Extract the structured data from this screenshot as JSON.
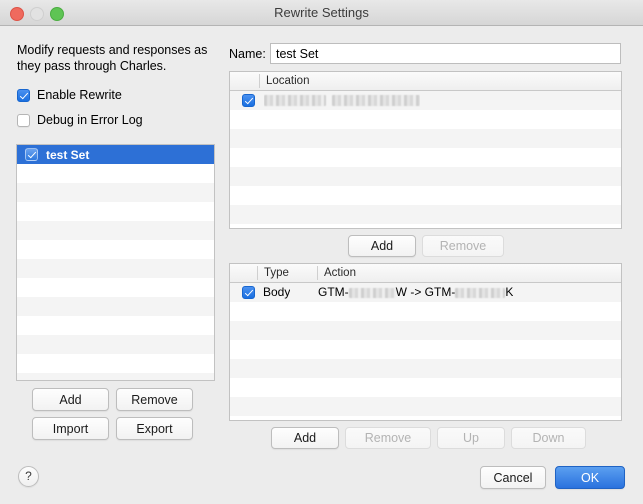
{
  "window": {
    "title": "Rewrite Settings",
    "controls": {
      "close": "close",
      "minimize": "minimize",
      "zoom": "zoom"
    }
  },
  "left_panel": {
    "description": "Modify requests and responses as they pass through Charles.",
    "checkboxes": [
      {
        "label": "Enable Rewrite",
        "checked": true
      },
      {
        "label": "Debug in Error Log",
        "checked": false
      }
    ],
    "sets": [
      {
        "label": "test Set",
        "checked": true,
        "selected": true
      }
    ],
    "buttons": {
      "add": "Add",
      "remove": "Remove",
      "import": "Import",
      "export": "Export"
    }
  },
  "right_panel": {
    "name_label": "Name:",
    "name_value": "test Set",
    "location_table": {
      "columns": [
        "",
        "Location"
      ],
      "rows": [
        {
          "checked": true,
          "location": "[redacted]"
        }
      ],
      "buttons": {
        "add": "Add",
        "remove": "Remove",
        "remove_disabled": true
      }
    },
    "action_table": {
      "columns": [
        "",
        "Type",
        "Action"
      ],
      "rows": [
        {
          "checked": true,
          "type": "Body",
          "action": "GTM-[redacted]W -> GTM-[redacted]K"
        }
      ],
      "buttons": {
        "add": "Add",
        "remove": "Remove",
        "up": "Up",
        "down": "Down",
        "remove_disabled": true,
        "up_disabled": true,
        "down_disabled": true
      }
    }
  },
  "footer": {
    "help": "?",
    "cancel": "Cancel",
    "ok": "OK"
  },
  "colors": {
    "accent": "#2d70d6",
    "window_bg": "#ececec",
    "titlebar": "#e0e0e0",
    "close": "#ef6a5e",
    "zoom": "#5fc454",
    "minimize": "#e2e2e2"
  }
}
